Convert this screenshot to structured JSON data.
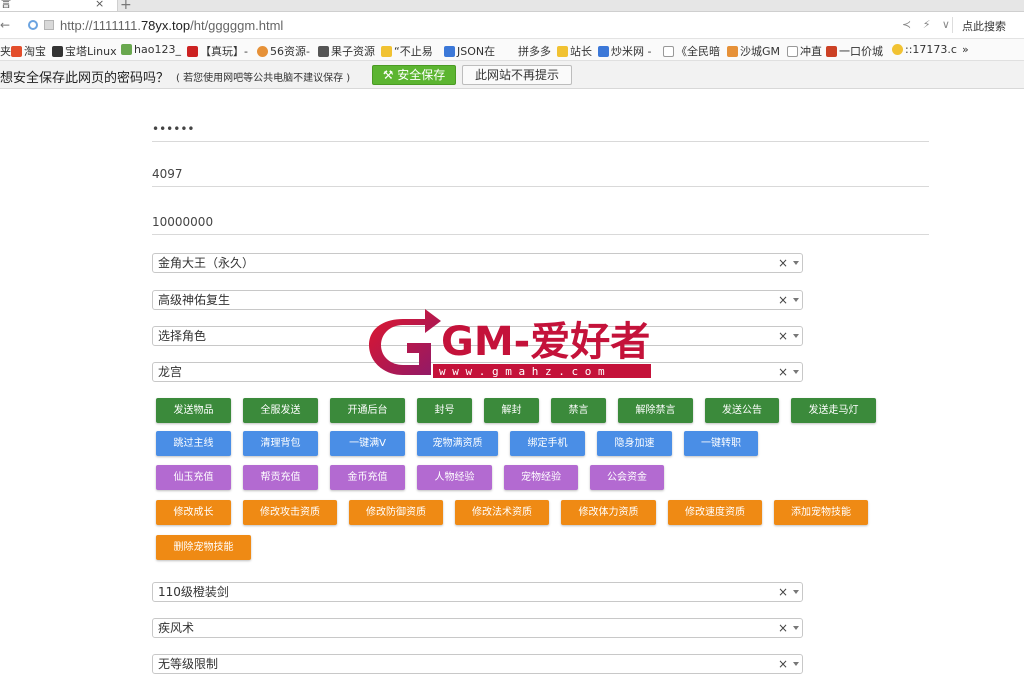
{
  "tab": {
    "title": "言",
    "close": "×",
    "new": "+"
  },
  "address": {
    "back": "←",
    "url_prefix": "http://1111111.",
    "url_domain": "78yx.top",
    "url_path": "/ht/gggggm.html",
    "tools": "≺ ⚡ ∨",
    "search_label": "点此搜索"
  },
  "bookmarks": [
    {
      "label": "夹",
      "color": "#999999"
    },
    {
      "label": "淘宝",
      "color": "#e34d2b"
    },
    {
      "label": "宝塔Linux",
      "color": "#333333"
    },
    {
      "label": "hao123_",
      "color": "#6aa84f"
    },
    {
      "label": "【真玩】-",
      "color": "#cc2222"
    },
    {
      "label": "56资源-",
      "color": "#e69138"
    },
    {
      "label": "果子资源",
      "color": "#555555"
    },
    {
      "label": "“不止易",
      "color": "#f1c232"
    },
    {
      "label": "JSON在",
      "color": "#3c78d8"
    },
    {
      "label": "拼多多",
      "color": "#ffffff"
    },
    {
      "label": "站长",
      "color": "#f1c232"
    },
    {
      "label": "炒米网 -",
      "color": "#3c78d8"
    },
    {
      "label": "《全民暗",
      "color": "#ffffff"
    },
    {
      "label": "沙城GM",
      "color": "#e69138"
    },
    {
      "label": "冲直",
      "color": "#ffffff"
    },
    {
      "label": "一口价城",
      "color": "#cc4125"
    },
    {
      "label": "::17173.c",
      "color": "#f1c232"
    },
    {
      "label": "»",
      "color": "#ffffff"
    }
  ],
  "password_bar": {
    "question": "想安全保存此网页的密码吗？",
    "note": "( 若您使用网吧等公共电脑不建议保存 )",
    "save_label": "安全保存",
    "never_label": "此网站不再提示"
  },
  "fields": {
    "password": "••••••",
    "role_id": "4097",
    "quantity": "10000000"
  },
  "selects": [
    {
      "value": "金角大王（永久）"
    },
    {
      "value": "高级神佑复生"
    },
    {
      "value": "选择角色"
    },
    {
      "value": "龙宫"
    }
  ],
  "select_clear": "×",
  "buttons": {
    "row1": [
      "发送物品",
      "全服发送",
      "开通后台",
      "封号",
      "解封",
      "禁言",
      "解除禁言",
      "发送公告",
      "发送走马灯"
    ],
    "row2": [
      "跳过主线",
      "清理背包",
      "一键满V",
      "宠物满资质",
      "绑定手机",
      "隐身加速",
      "一键转职"
    ],
    "row3": [
      "仙玉充值",
      "帮贡充值",
      "金币充值",
      "人物经验",
      "宠物经验",
      "公会资金"
    ],
    "row4": [
      "修改成长",
      "修改攻击资质",
      "修改防御资质",
      "修改法术资质",
      "修改体力资质",
      "修改速度资质",
      "添加宠物技能"
    ],
    "row5": [
      "删除宠物技能"
    ]
  },
  "lower_selects": [
    {
      "value": "110级橙装剑"
    },
    {
      "value": "疾风术"
    },
    {
      "value": "无等级限制"
    }
  ],
  "watermark": {
    "text": "GM-爱好者",
    "url": "w w w . g m a h z . c o m"
  },
  "colors": {
    "green": "#3b8a3b",
    "blue": "#4a8ee6",
    "purple": "#b36ad1",
    "orange": "#ef8a14",
    "save_green": "#5cb531"
  }
}
